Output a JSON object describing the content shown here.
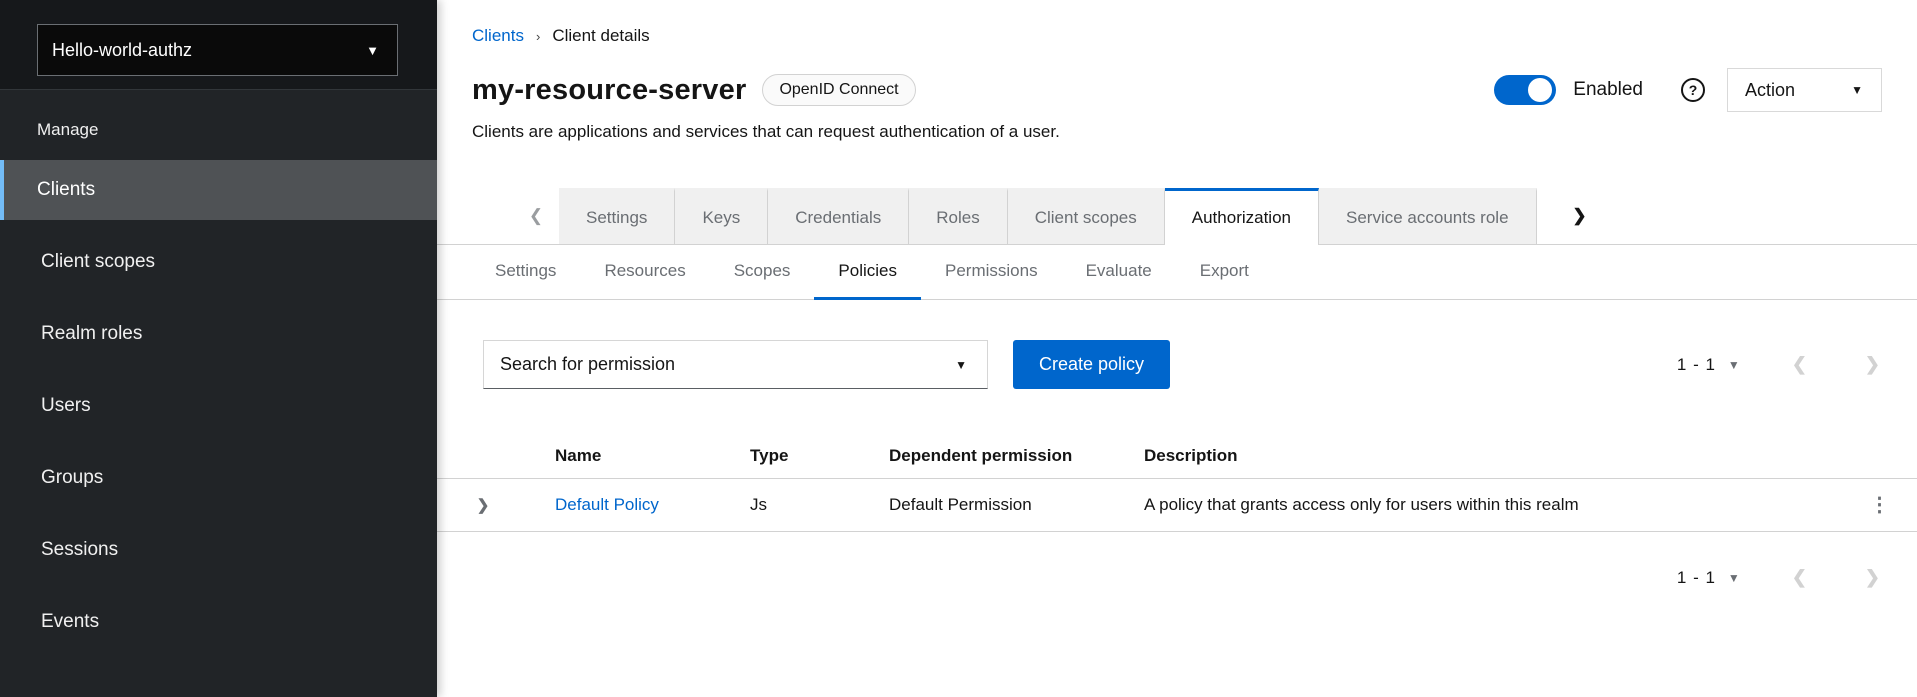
{
  "sidebar": {
    "realm_selector": {
      "label": "Hello-world-authz",
      "caret_icon": "▼"
    },
    "section_label": "Manage",
    "items": [
      {
        "label": "Clients",
        "active": true
      },
      {
        "label": "Client scopes",
        "active": false
      },
      {
        "label": "Realm roles",
        "active": false
      },
      {
        "label": "Users",
        "active": false
      },
      {
        "label": "Groups",
        "active": false
      },
      {
        "label": "Sessions",
        "active": false
      },
      {
        "label": "Events",
        "active": false
      }
    ]
  },
  "breadcrumb": {
    "link": "Clients",
    "separator": "›",
    "current": "Client details"
  },
  "header": {
    "title": "my-resource-server",
    "badge": "OpenID Connect",
    "subtitle": "Clients are applications and services that can request authentication of a user.",
    "toggle_label": "Enabled",
    "toggle_state": "on",
    "help_icon": "?",
    "action_label": "Action",
    "action_caret": "▼"
  },
  "tabs": {
    "scroll_left_icon": "❮",
    "scroll_right_icon": "❯",
    "items": [
      {
        "label": "Settings",
        "active": false
      },
      {
        "label": "Keys",
        "active": false
      },
      {
        "label": "Credentials",
        "active": false
      },
      {
        "label": "Roles",
        "active": false
      },
      {
        "label": "Client scopes",
        "active": false
      },
      {
        "label": "Authorization",
        "active": true
      },
      {
        "label": "Service accounts role",
        "active": false
      }
    ]
  },
  "subtabs": {
    "items": [
      {
        "label": "Settings",
        "active": false
      },
      {
        "label": "Resources",
        "active": false
      },
      {
        "label": "Scopes",
        "active": false
      },
      {
        "label": "Policies",
        "active": true
      },
      {
        "label": "Permissions",
        "active": false
      },
      {
        "label": "Evaluate",
        "active": false
      },
      {
        "label": "Export",
        "active": false
      }
    ]
  },
  "toolbar": {
    "search_label": "Search for permission",
    "search_caret": "▼",
    "create_label": "Create policy"
  },
  "pagination": {
    "range": "1 - 1",
    "caret": "▼",
    "prev_icon": "❮",
    "next_icon": "❯"
  },
  "table": {
    "columns": {
      "name": "Name",
      "type": "Type",
      "dependent": "Dependent permission",
      "description": "Description"
    },
    "row": {
      "expand_icon": "❯",
      "name": "Default Policy",
      "type": "Js",
      "dependent": "Default Permission",
      "description": "A policy that grants access only for users within this realm",
      "kebab_icon": "⋮"
    }
  },
  "colors": {
    "accent": "#0066cc",
    "link": "#0066cc",
    "sidebar_background": "#212427",
    "sidebar_active_background": "#4f5255",
    "sidebar_active_accent": "#73bcf7",
    "tab_background": "#f0f0f0",
    "border": "#d2d2d2",
    "text": "#151515",
    "muted_text": "#6a6e73"
  }
}
